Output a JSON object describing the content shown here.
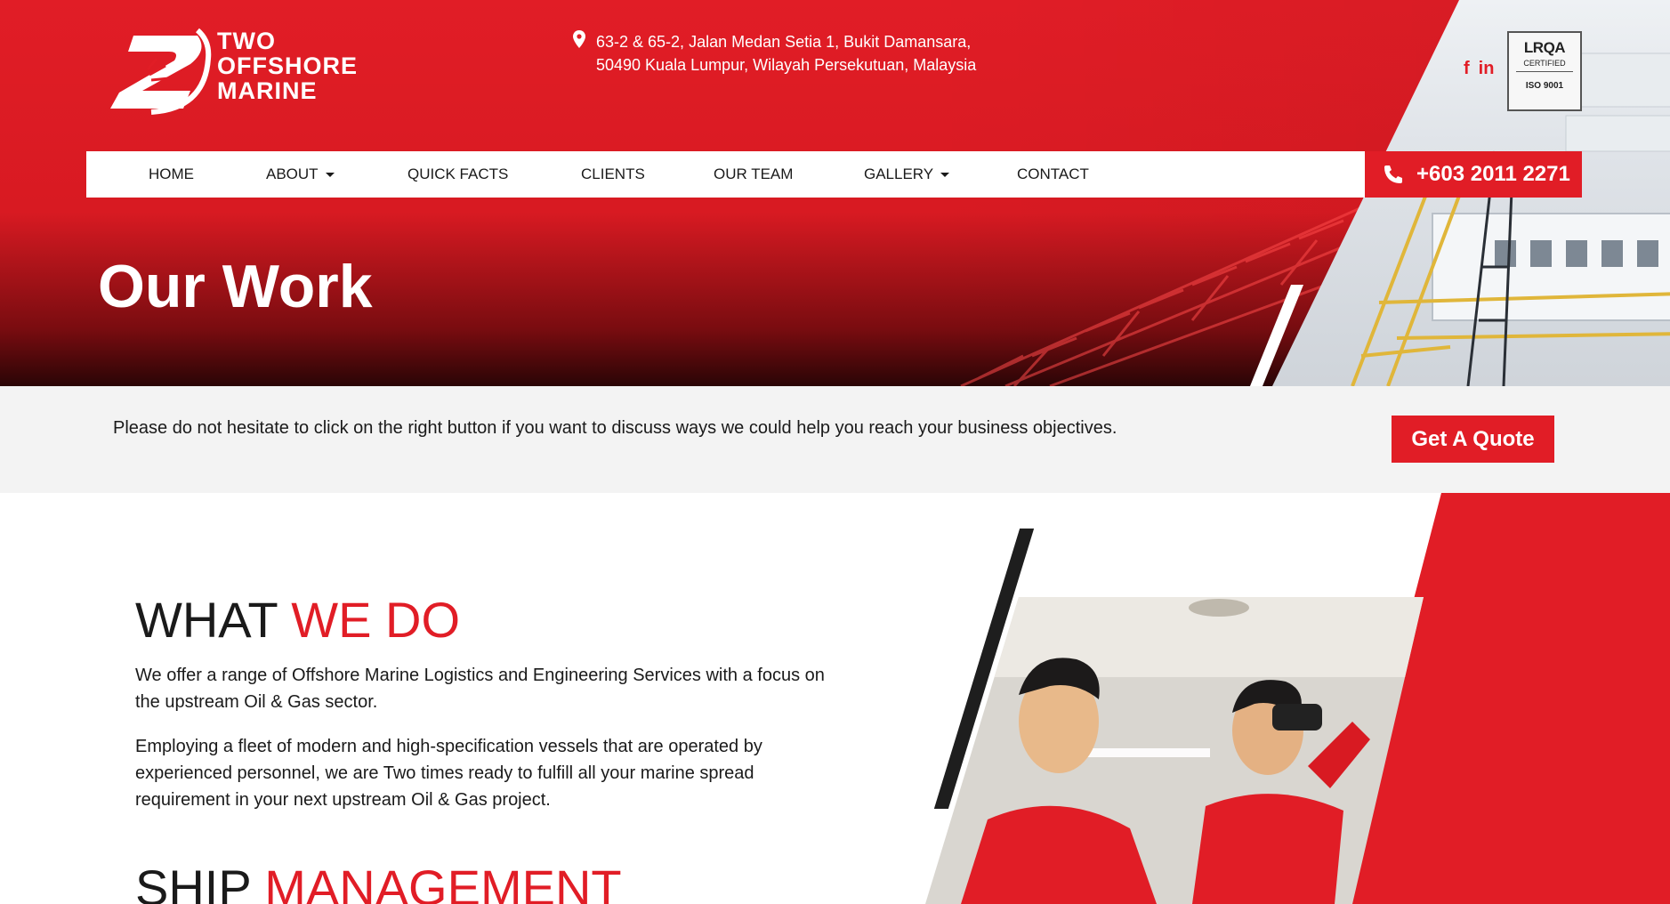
{
  "brand": {
    "logo_line1": "TWO",
    "logo_line2": "OFFSHORE",
    "logo_line3": "MARINE",
    "accent_color": "#e11d26"
  },
  "header": {
    "address_line1": "63-2 & 65-2, Jalan Medan Setia 1, Bukit Damansara,",
    "address_line2": "50490 Kuala Lumpur, Wilayah Persekutuan, Malaysia",
    "social": [
      "f",
      "in"
    ],
    "cert": {
      "name": "LRQA",
      "status": "CERTIFIED",
      "standard": "ISO 9001"
    }
  },
  "nav": {
    "items": [
      "HOME",
      "ABOUT",
      "QUICK FACTS",
      "CLIENTS",
      "OUR TEAM",
      "GALLERY",
      "CONTACT"
    ],
    "phone": "+603 2011 2271"
  },
  "hero": {
    "title": "Our Work"
  },
  "cta": {
    "text": "Please do not hesitate to click on the right button if you want to discuss ways we could help you reach your business objectives.",
    "button": "Get A Quote"
  },
  "what_we_do": {
    "heading_dark": "WHAT",
    "heading_accent": "WE DO",
    "para1": "We offer a range of Offshore Marine Logistics and Engineering Services with a focus on the upstream Oil & Gas sector.",
    "para2": "Employing a fleet of modern and high-specification vessels that are operated by experienced personnel, we are Two times ready to fulfill all your marine spread requirement in your next upstream Oil & Gas project."
  },
  "ship_management": {
    "heading_dark": "SHIP",
    "heading_accent": "MANAGEMENT"
  }
}
